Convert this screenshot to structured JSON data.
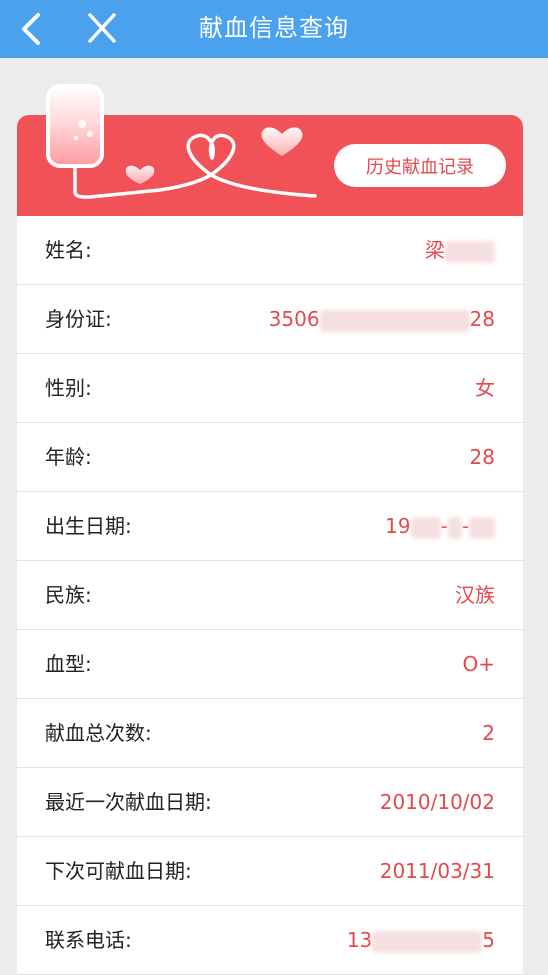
{
  "header": {
    "title": "献血信息查询",
    "color": "#4aa1ee"
  },
  "banner": {
    "color": "#f05258",
    "history_button": "历史献血记录"
  },
  "fields": [
    {
      "label": "姓名:",
      "value_prefix": "梁",
      "value_suffix": "",
      "masked": true
    },
    {
      "label": "身份证:",
      "value_prefix": "3506",
      "value_suffix": "28",
      "masked": true
    },
    {
      "label": "性别:",
      "value_prefix": "女",
      "value_suffix": "",
      "masked": false
    },
    {
      "label": "年龄:",
      "value_prefix": "28",
      "value_suffix": "",
      "masked": false
    },
    {
      "label": "出生日期:",
      "value_prefix": "19",
      "value_suffix": "",
      "masked": true
    },
    {
      "label": "民族:",
      "value_prefix": "汉族",
      "value_suffix": "",
      "masked": false
    },
    {
      "label": "血型:",
      "value_prefix": "O+",
      "value_suffix": "",
      "masked": false
    },
    {
      "label": "献血总次数:",
      "value_prefix": "2",
      "value_suffix": "",
      "masked": false
    },
    {
      "label": "最近一次献血日期:",
      "value_prefix": "2010/10/02",
      "value_suffix": "",
      "masked": false
    },
    {
      "label": "下次可献血日期:",
      "value_prefix": "2011/03/31",
      "value_suffix": "",
      "masked": false
    },
    {
      "label": "联系电话:",
      "value_prefix": "13",
      "value_suffix": "5",
      "masked": true
    }
  ]
}
